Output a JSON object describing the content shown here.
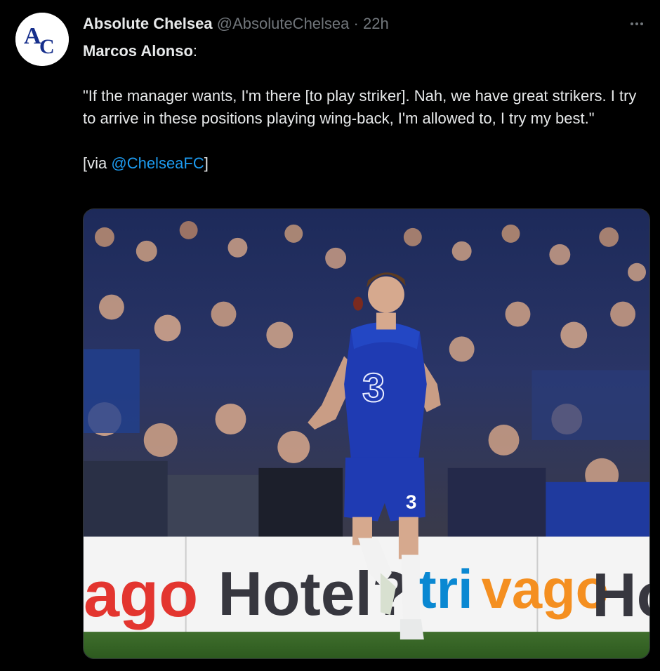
{
  "tweet": {
    "author_name": "Absolute Chelsea",
    "handle": "@AbsoluteChelsea",
    "separator": "·",
    "time": "22h",
    "avatar_text": "AC",
    "speaker": "Marcos Alonso",
    "speaker_suffix": ":",
    "quote": "\"If the manager wants, I'm there [to play striker]. Nah, we have great strikers. I try to arrive in these positions playing wing-back, I'm allowed to, I try my best.\"",
    "via_prefix": "[via ",
    "via_link": "@ChelseaFC",
    "via_suffix": "]"
  },
  "media": {
    "board_text_left": "ago",
    "board_text_middle": "Hotel?",
    "board_text_right_a": "tri",
    "board_text_right_b": "vago",
    "board_text_far": "Ho",
    "shirt_number": "3",
    "shorts_number": "3"
  },
  "colors": {
    "background": "#000000",
    "link": "#1d9bf0",
    "muted": "#71767b",
    "kit_blue": "#1f3bb3",
    "trivago_blue": "#0a88d2",
    "trivago_orange": "#f48f20",
    "trivago_red": "#e3352f"
  },
  "icons": {
    "more": "more-horizontal-icon"
  }
}
